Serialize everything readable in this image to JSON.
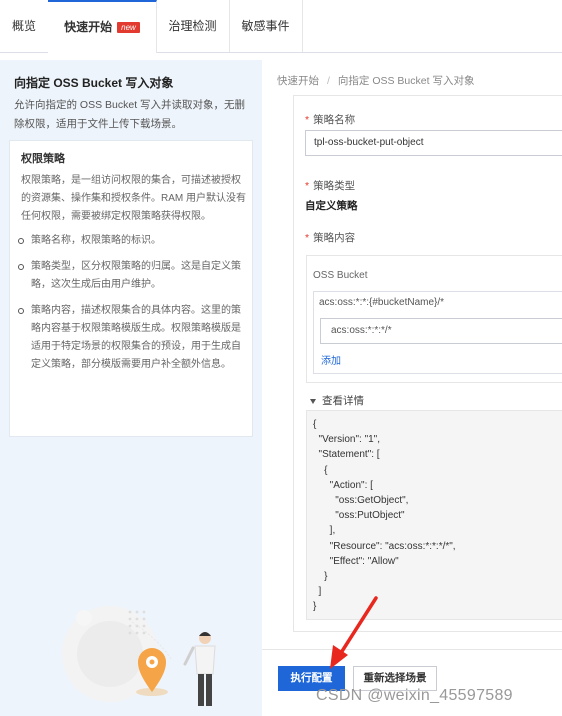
{
  "tabs": [
    {
      "label": "概览"
    },
    {
      "label": "快速开始",
      "badge": "new"
    },
    {
      "label": "治理检测"
    },
    {
      "label": "敏感事件"
    }
  ],
  "left": {
    "title": "向指定 OSS Bucket 写入对象",
    "desc": "允许向指定的 OSS Bucket 写入并读取对象，无删除权限，适用于文件上传下载场景。",
    "info_title": "权限策略",
    "info_text": "权限策略，是一组访问权限的集合，可描述被授权的资源集、操作集和授权条件。RAM 用户默认没有任何权限，需要被绑定权限策略获得权限。",
    "bullets": [
      "策略名称，权限策略的标识。",
      "策略类型，区分权限策略的归属。这是自定义策略，这次生成后由用户维护。",
      "策略内容，描述权限集合的具体内容。这里的策略内容基于权限策略模版生成。权限策略模版是适用于特定场景的权限集合的预设，用于生成自定义策略，部分模版需要用户补全额外信息。"
    ]
  },
  "breadcrumb": {
    "root": "快速开始",
    "sep": "/",
    "current": "向指定 OSS Bucket 写入对象"
  },
  "form": {
    "name_label": "策略名称",
    "name_value": "tpl-oss-bucket-put-object",
    "type_label": "策略类型",
    "type_value": "自定义策略",
    "content_label": "策略内容",
    "oss_label": "OSS Bucket",
    "oss_main": "acs:oss:*:*:{#bucketName}/*",
    "oss_sub": "acs:oss:*:*:*/*",
    "add_label": "添加",
    "details_label": "查看详情",
    "json_text": "{\n  \"Version\": \"1\",\n  \"Statement\": [\n    {\n      \"Action\": [\n        \"oss:GetObject\",\n        \"oss:PutObject\"\n      ],\n      \"Resource\": \"acs:oss:*:*:*/*\",\n      \"Effect\": \"Allow\"\n    }\n  ]\n}"
  },
  "buttons": {
    "execute": "执行配置",
    "reselect": "重新选择场景"
  },
  "watermark": "CSDN @weixin_45597589",
  "colors": {
    "primary": "#1f67d8",
    "required": "#e23a2e",
    "badge": "#e23a2e",
    "arrow": "#e8281e"
  }
}
